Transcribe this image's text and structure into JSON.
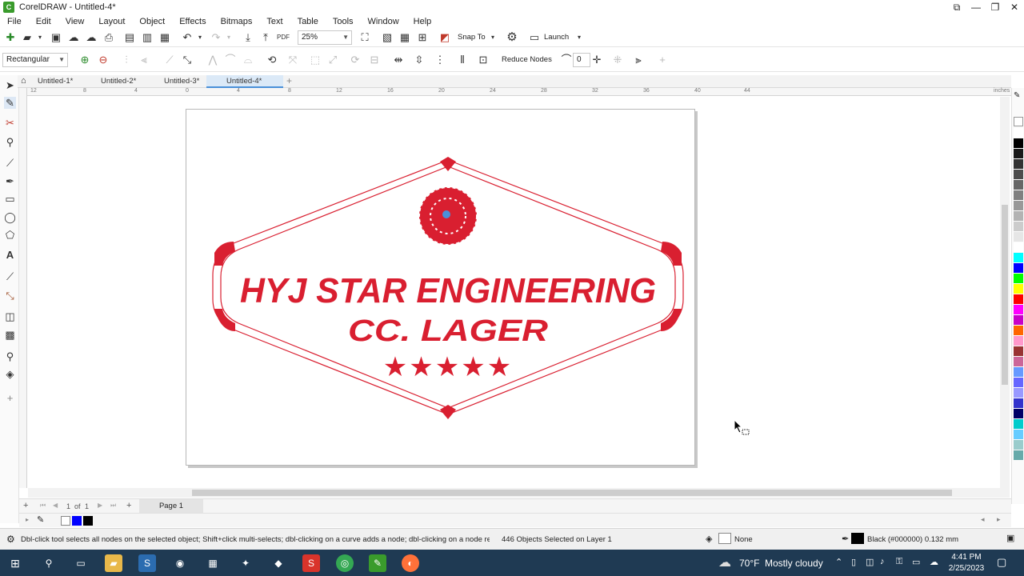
{
  "window": {
    "title": "CorelDRAW - Untitled-4*",
    "min": "—",
    "max": "❐",
    "close": "✕",
    "restore": "⧉"
  },
  "menu": [
    "File",
    "Edit",
    "View",
    "Layout",
    "Object",
    "Effects",
    "Bitmaps",
    "Text",
    "Table",
    "Tools",
    "Window",
    "Help"
  ],
  "toolbar": {
    "zoom": "25%",
    "snap_to": "Snap To",
    "launch": "Launch"
  },
  "propbar": {
    "selection_mode": "Rectangular",
    "reduce_nodes": "Reduce Nodes",
    "curve_smoothness": "0"
  },
  "doc_tabs": [
    {
      "label": "Untitled-1*",
      "active": false
    },
    {
      "label": "Untitled-2*",
      "active": false
    },
    {
      "label": "Untitled-3*",
      "active": false
    },
    {
      "label": "Untitled-4*",
      "active": true
    }
  ],
  "ruler": {
    "unit": "inches",
    "marks": [
      "12",
      "8",
      "4",
      "0",
      "4",
      "8",
      "12",
      "16",
      "20",
      "24",
      "28",
      "32",
      "36",
      "40",
      "44"
    ]
  },
  "design": {
    "title_text": "HYJ STAR ENGINEERING",
    "subtitle_text": "CC. LAGER",
    "stars": "★★★★★",
    "color": "#d91f30"
  },
  "page_nav": {
    "counter": "1",
    "of_label": "of",
    "total": "1",
    "page_tab": "Page 1"
  },
  "status": {
    "hint": "Dbl-click tool selects all nodes on the selected object; Shift+click multi-selects; dbl-clicking on a curve adds a node; dbl-clicking on a node removes it",
    "selection": "446 Objects Selected on Layer 1",
    "fill": "None",
    "outline": "Black (#000000)  0.132 mm"
  },
  "taskbar": {
    "weather_temp": "70°F",
    "weather_desc": "Mostly cloudy",
    "time": "4:41 PM",
    "date": "2/25/2023"
  },
  "palette_colors": [
    "#ffffff",
    "#000000",
    "#1a1a1a",
    "#333333",
    "#4d4d4d",
    "#666666",
    "#808080",
    "#999999",
    "#b3b3b3",
    "#cccccc",
    "#e6e6e6",
    "#ffffff",
    "#00ffff",
    "#0000ff",
    "#00ff00",
    "#ffff00",
    "#ff0000",
    "#ff00ff",
    "#c800c8",
    "#ff6600",
    "#ff99cc",
    "#993333",
    "#cc6699",
    "#6699ff",
    "#6666ff",
    "#9999ff",
    "#3333cc",
    "#000066",
    "#00cccc",
    "#66ccff",
    "#99cccc",
    "#66aaaa"
  ]
}
